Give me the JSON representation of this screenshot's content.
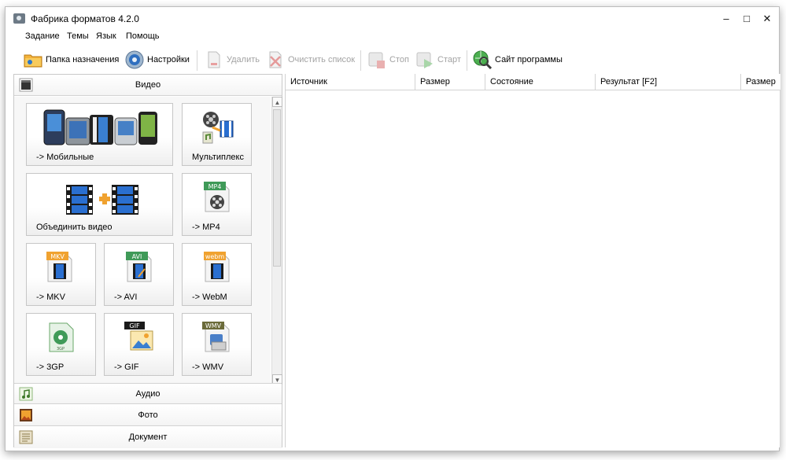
{
  "window": {
    "title": "Фабрика форматов 4.2.0",
    "controls": {
      "minimize": "–",
      "maximize": "□",
      "close": "✕"
    }
  },
  "menu": [
    "Задание",
    "Темы",
    "Язык",
    "Помощь"
  ],
  "toolbar": {
    "destination": "Папка назначения",
    "settings": "Настройки",
    "delete": "Удалить",
    "clear_list": "Очистить список",
    "stop": "Стоп",
    "start": "Старт",
    "website": "Сайт программы"
  },
  "categories": {
    "video": "Видео",
    "audio": "Аудио",
    "photo": "Фото",
    "document": "Документ"
  },
  "video_tiles": [
    {
      "label": "-> Мобильные",
      "icon": "mobile-devices-icon"
    },
    {
      "label": "Мультиплекс",
      "icon": "multiplex-icon"
    },
    {
      "label": "Объединить видео",
      "icon": "join-video-icon"
    },
    {
      "label": "-> MP4",
      "icon": "mp4-icon",
      "badge": "MP4"
    },
    {
      "label": "-> MKV",
      "icon": "mkv-icon",
      "badge": "MKV"
    },
    {
      "label": "-> AVI",
      "icon": "avi-icon",
      "badge": "AVI"
    },
    {
      "label": "-> WebM",
      "icon": "webm-icon",
      "badge": "webm"
    },
    {
      "label": "-> 3GP",
      "icon": "3gp-icon",
      "badge": "3GP"
    },
    {
      "label": "-> GIF",
      "icon": "gif-icon",
      "badge": "GIF"
    },
    {
      "label": "-> WMV",
      "icon": "wmv-icon",
      "badge": "WMV"
    }
  ],
  "columns": [
    "Источник",
    "Размер",
    "Состояние",
    "Результат [F2]",
    "Размер"
  ],
  "colors": {
    "accent_orange": "#f0a230",
    "film_blue": "#2a6fd0",
    "disabled_text": "#a3a3a3"
  }
}
